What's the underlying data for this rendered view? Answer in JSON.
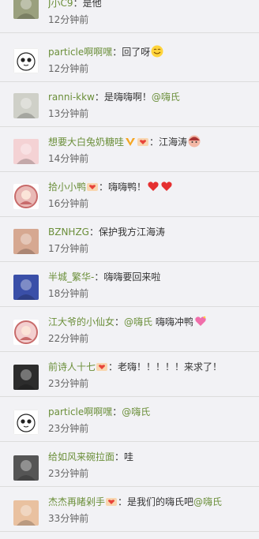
{
  "comments": [
    {
      "user": "J小C9",
      "sep": "：",
      "content": "是他",
      "mention": "",
      "content2": "",
      "time": "12分钟前",
      "badges": [],
      "emojis": [],
      "avatar_color": "#9aa07e"
    },
    {
      "user": "particle啊啊嘿",
      "sep": "：",
      "content": "回了呀",
      "mention": "",
      "content2": "",
      "time": "12分钟前",
      "badges": [],
      "emojis": [
        "smile-emoji"
      ],
      "avatar_color": "#ffffff"
    },
    {
      "user": "ranni-kkw",
      "sep": "：",
      "content": "是嗨嗨啊！",
      "mention": "@嗨氏",
      "content2": "",
      "time": "13分钟前",
      "badges": [],
      "emojis": [],
      "avatar_color": "#cfd0c8"
    },
    {
      "user": "想要大白兔奶糖哇",
      "sep": "：",
      "content": "江海涛",
      "mention": "",
      "content2": "",
      "time": "14分钟前",
      "badges": [
        "v-badge",
        "fan-badge"
      ],
      "emojis": [
        "face-emoji"
      ],
      "avatar_color": "#f4d2d4"
    },
    {
      "user": "拾小小鸭",
      "sep": "：",
      "content": "嗨嗨鸭！",
      "mention": "",
      "content2": "",
      "time": "16分钟前",
      "badges": [
        "fan-badge"
      ],
      "emojis": [
        "heart-emoji",
        "heart-emoji"
      ],
      "avatar_color": "#e9b9b6"
    },
    {
      "user": "BZNHZG",
      "sep": "：",
      "content": "保护我方江海涛",
      "mention": "",
      "content2": "",
      "time": "17分钟前",
      "badges": [],
      "emojis": [],
      "avatar_color": "#d6a891"
    },
    {
      "user": "半城_繁华-",
      "sep": "：",
      "content": "嗨嗨要回来啦",
      "mention": "",
      "content2": "",
      "time": "18分钟前",
      "badges": [],
      "emojis": [],
      "avatar_color": "#3a4fa8"
    },
    {
      "user": "江大爷的小仙女",
      "sep": "：",
      "content": "",
      "mention": "@嗨氏",
      "content2": "嗨嗨冲鸭",
      "time": "22分钟前",
      "badges": [],
      "emojis": [
        "heart-sparkle-emoji"
      ],
      "avatar_color": "#f3cfcf"
    },
    {
      "user": "前诗人十七",
      "sep": "：",
      "content": "老嗨！！！！！来求了！",
      "mention": "",
      "content2": "",
      "time": "23分钟前",
      "badges": [
        "fan-badge"
      ],
      "emojis": [],
      "avatar_color": "#2c2c2c"
    },
    {
      "user": "particle啊啊嘿",
      "sep": "：",
      "content": "",
      "mention": "@嗨氏",
      "content2": "",
      "time": "23分钟前",
      "badges": [],
      "emojis": [],
      "avatar_color": "#ffffff"
    },
    {
      "user": "给如风来碗拉面",
      "sep": "：",
      "content": "哇",
      "mention": "",
      "content2": "",
      "time": "23分钟前",
      "badges": [],
      "emojis": [],
      "avatar_color": "#555555"
    },
    {
      "user": "杰杰再睹剁手",
      "sep": "：",
      "content": "是我们的嗨氏吧",
      "mention": "@嗨氏",
      "content2": "",
      "time": "33分钟前",
      "badges": [
        "fan-badge"
      ],
      "emojis": [],
      "avatar_color": "#e9c1a0"
    }
  ]
}
